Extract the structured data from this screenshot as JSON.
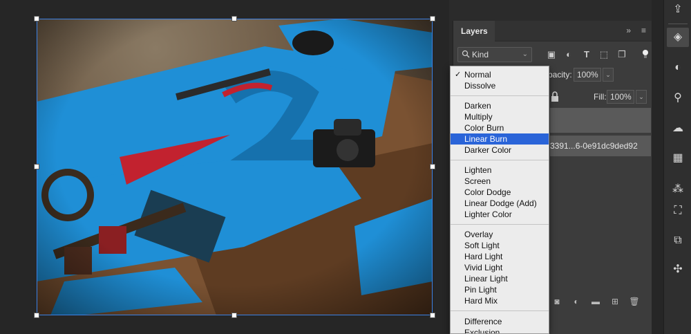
{
  "layers_panel": {
    "tab_label": "Layers",
    "collapse_glyph": "»",
    "menu_glyph": "≡",
    "kind_filter": {
      "value": "Kind",
      "icon": "search-icon"
    },
    "filter_icons": [
      "image-filter-icon",
      "adjustment-filter-icon",
      "type-filter-icon",
      "shape-filter-icon",
      "smart-object-filter-icon"
    ],
    "opacity": {
      "label": "pacity:",
      "value": "100%"
    },
    "fill": {
      "label": "Fill:",
      "value": "100%"
    },
    "layer_name_visible": "3391...6-0e91dc9ded92",
    "footer_icons": [
      "add-mask-icon",
      "adjustment-layer-icon",
      "group-folder-icon",
      "new-layer-icon",
      "trash-icon"
    ]
  },
  "blend_menu": {
    "checked_item": "Normal",
    "highlighted_item": "Linear Burn",
    "groups": [
      [
        "Normal",
        "Dissolve"
      ],
      [
        "Darken",
        "Multiply",
        "Color Burn",
        "Linear Burn",
        "Darker Color"
      ],
      [
        "Lighten",
        "Screen",
        "Color Dodge",
        "Linear Dodge (Add)",
        "Lighter Color"
      ],
      [
        "Overlay",
        "Soft Light",
        "Hard Light",
        "Vivid Light",
        "Linear Light",
        "Pin Light",
        "Hard Mix"
      ],
      [
        "Difference",
        "Exclusion"
      ]
    ]
  },
  "right_toolbar": {
    "buttons": [
      "share-icon",
      "layers-icon",
      "adjustments-icon",
      "properties-icon",
      "creative-cloud-icon",
      "grid-icon",
      "color-icon",
      "paths-icon",
      "channels-icon",
      "swatches-icon"
    ]
  },
  "colors": {
    "accent_blue": "#2a64d8",
    "image_overlay_blue": "#1f8fd6",
    "panel_bg": "#3c3c3c",
    "menu_bg": "#ececec",
    "selection_border": "#3c82e6"
  }
}
